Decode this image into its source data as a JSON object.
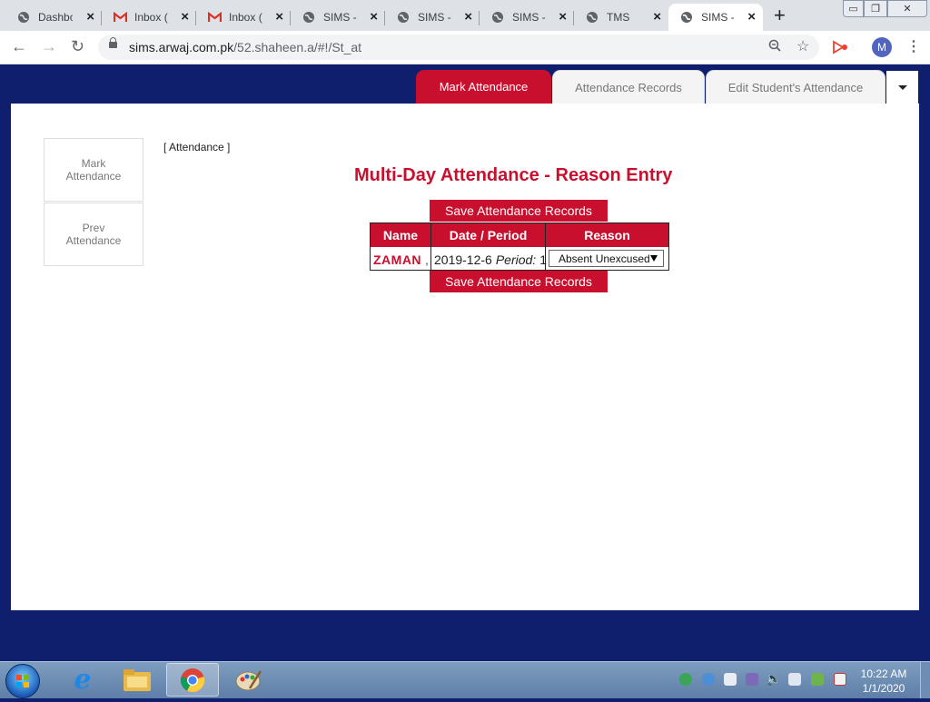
{
  "browser": {
    "tabs": [
      {
        "title": "Dashbo",
        "icon": "globe-icon"
      },
      {
        "title": "Inbox (",
        "icon": "gmail-icon"
      },
      {
        "title": "Inbox (",
        "icon": "gmail-icon"
      },
      {
        "title": "SIMS -",
        "icon": "globe-icon"
      },
      {
        "title": "SIMS -",
        "icon": "globe-icon"
      },
      {
        "title": "SIMS -",
        "icon": "globe-icon"
      },
      {
        "title": "TMS",
        "icon": "globe-icon"
      },
      {
        "title": "SIMS -",
        "icon": "globe-icon",
        "active": true
      }
    ],
    "url_host": "sims.arwaj.com.pk",
    "url_path": "/52.shaheen.a/#!/St_at",
    "profile_initial": "M"
  },
  "app": {
    "tabs": {
      "mark": "Mark Attendance",
      "records": "Attendance Records",
      "edit": "Edit Student's Attendance"
    },
    "sidebar": {
      "mark": "Mark\nAttendance",
      "prev": "Prev\nAttendance"
    },
    "breadcrumb": "[ Attendance ]",
    "heading": "Multi-Day Attendance - Reason Entry",
    "save_label": "Save Attendance Records",
    "table": {
      "headers": {
        "name": "Name",
        "date": "Date / Period",
        "reason": "Reason"
      },
      "row": {
        "name": "ZAMAN",
        "name_suffix": ",",
        "date": "2019-12-6",
        "period_label": "Period:",
        "period": "1",
        "reason": "Absent Unexcused"
      }
    },
    "colors": {
      "accent": "#c8102e",
      "page_bg": "#0f1f6e"
    }
  },
  "taskbar": {
    "time": "10:22 AM",
    "date": "1/1/2020"
  }
}
